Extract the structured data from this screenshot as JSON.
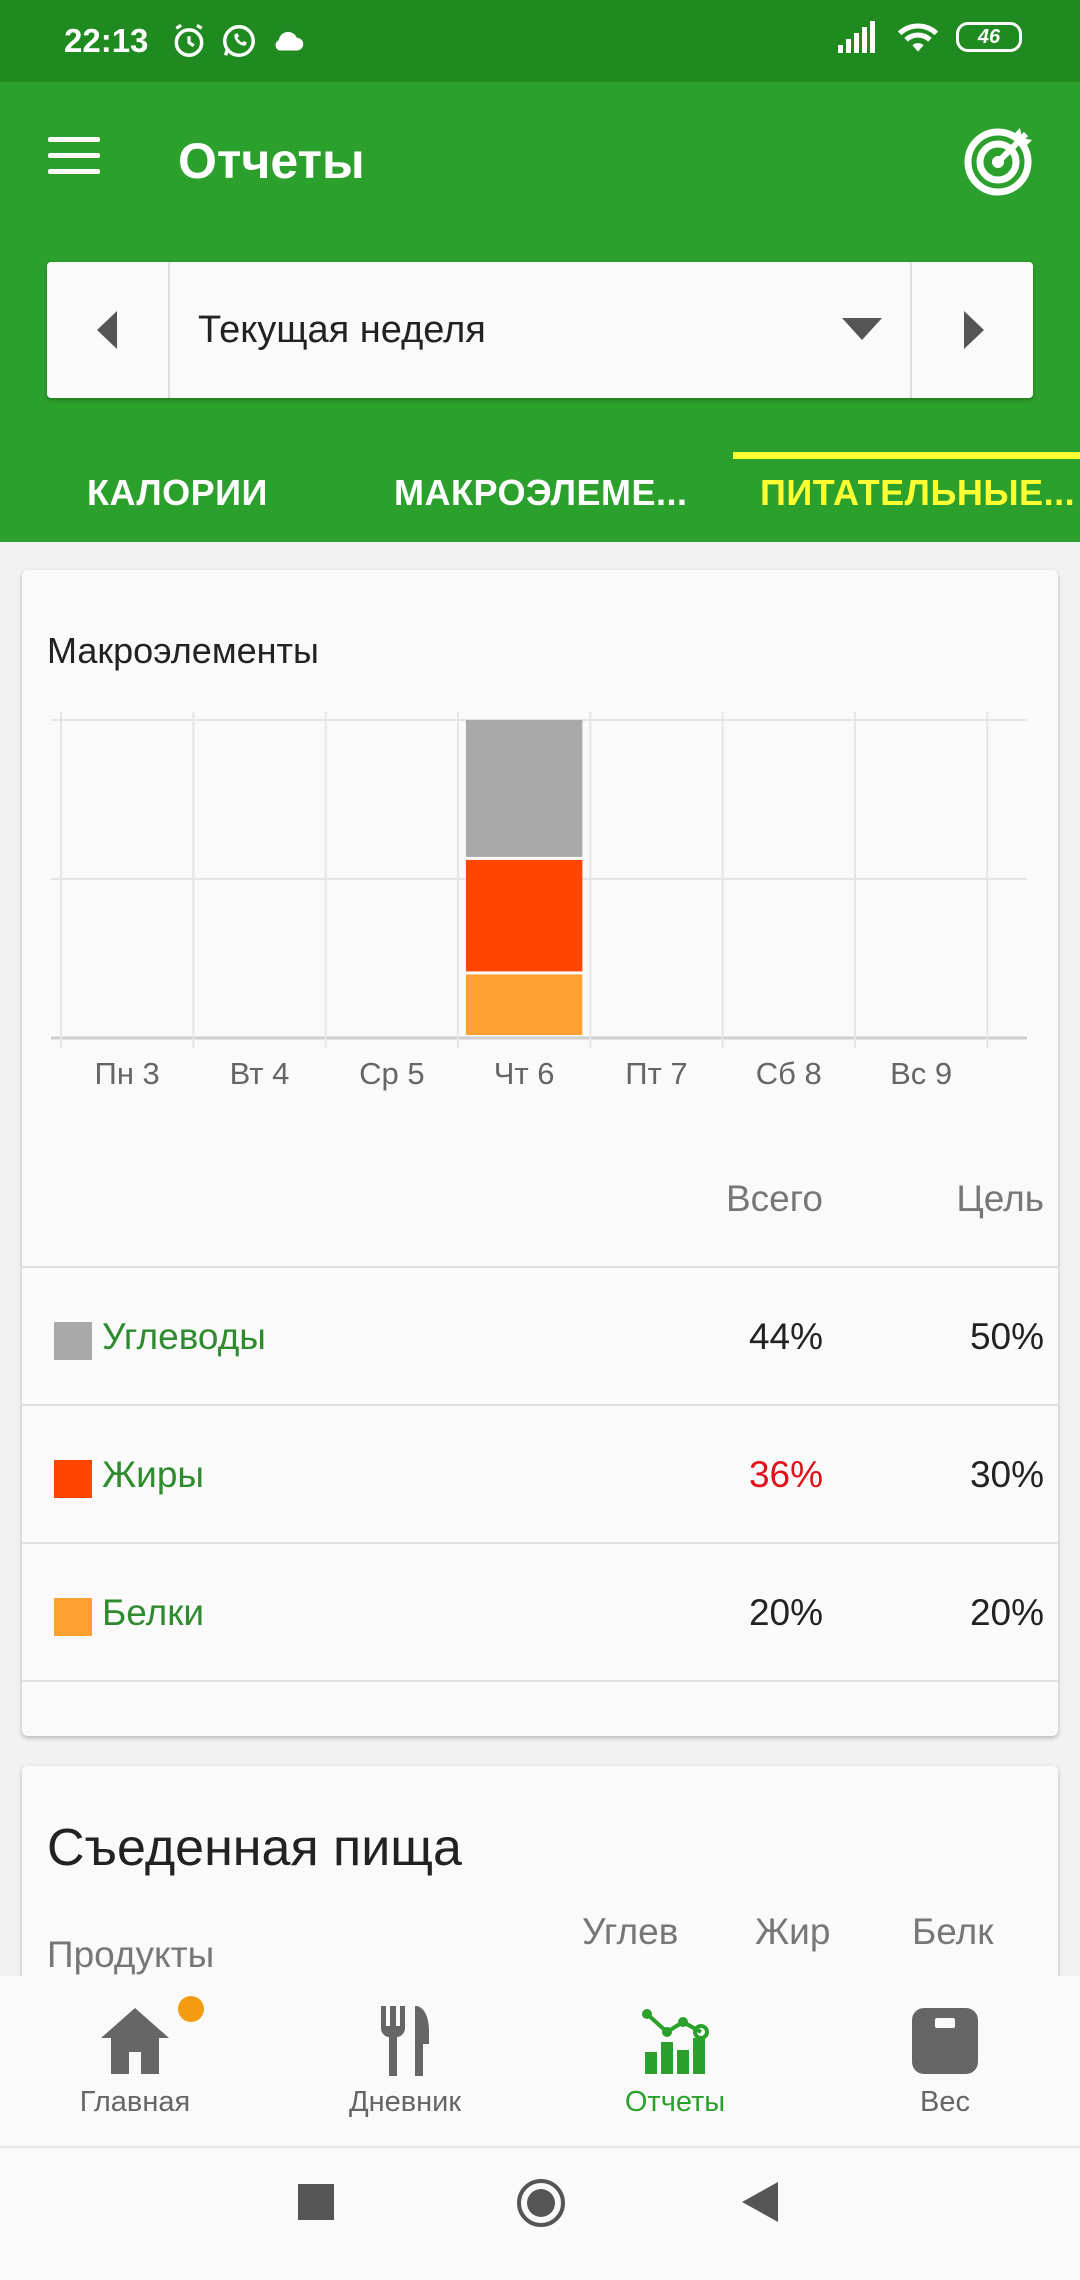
{
  "status_bar": {
    "time": "22:13",
    "battery": "46",
    "icons": [
      "alarm-icon",
      "whatsapp-icon",
      "cloud-icon",
      "signal-icon",
      "wifi-icon",
      "battery-icon"
    ]
  },
  "app_bar": {
    "title": "Отчеты",
    "week_label": "Текущая неделя"
  },
  "tabs": [
    {
      "label": "КАЛОРИИ",
      "active": false
    },
    {
      "label": "МАКРОЭЛЕМЕ...",
      "active": false
    },
    {
      "label": "ПИТАТЕЛЬНЫЕ...",
      "active": true
    }
  ],
  "macro_card": {
    "title": "Макроэлементы",
    "header_total": "Всего",
    "header_goal": "Цель",
    "rows": [
      {
        "label": "Углеводы",
        "total": "44%",
        "goal": "50%",
        "color": "#a9a9a9",
        "total_color": "#222222"
      },
      {
        "label": "Жиры",
        "total": "36%",
        "goal": "30%",
        "color": "#ff4500",
        "total_color": "#e0101a"
      },
      {
        "label": "Белки",
        "total": "20%",
        "goal": "20%",
        "color": "#ffa033",
        "total_color": "#222222"
      }
    ]
  },
  "chart_data": {
    "type": "bar",
    "stacked": true,
    "categories": [
      "Пн 3",
      "Вт 4",
      "Ср 5",
      "Чт 6",
      "Пт 7",
      "Сб 8",
      "Вс 9"
    ],
    "series": [
      {
        "name": "Белки",
        "color": "#ffa033",
        "values": [
          0,
          0,
          0,
          20,
          0,
          0,
          0
        ]
      },
      {
        "name": "Жиры",
        "color": "#ff4500",
        "values": [
          0,
          0,
          0,
          36,
          0,
          0,
          0
        ]
      },
      {
        "name": "Углеводы",
        "color": "#a9a9a9",
        "values": [
          0,
          0,
          0,
          44,
          0,
          0,
          0
        ]
      }
    ],
    "ylim": [
      0,
      100
    ],
    "grid": true
  },
  "food_card": {
    "title": "Съеденная пища",
    "col_products": "Продукты",
    "col_carbs": "Углев",
    "col_fat": "Жир",
    "col_protein": "Белк"
  },
  "bottom_nav": [
    {
      "label": "Главная",
      "icon": "home-icon",
      "active": false,
      "badge": true
    },
    {
      "label": "Дневник",
      "icon": "fork-knife-icon",
      "active": false,
      "badge": false
    },
    {
      "label": "Отчеты",
      "icon": "chart-icon",
      "active": true,
      "badge": false
    },
    {
      "label": "Вес",
      "icon": "scale-icon",
      "active": false,
      "badge": false
    }
  ],
  "colors": {
    "primary": "#2ca02c",
    "status_bar": "#1f8a1f",
    "tab_active": "#ffff33",
    "accent_badge": "#f39c12"
  }
}
